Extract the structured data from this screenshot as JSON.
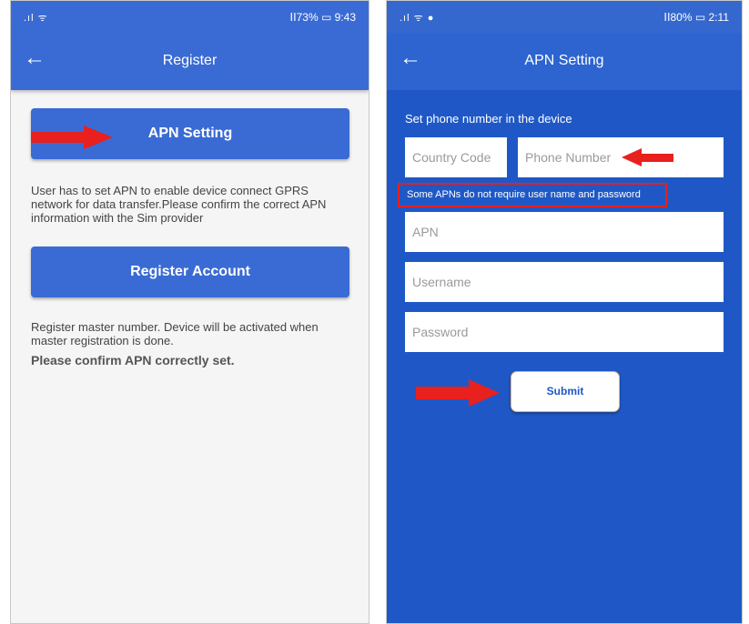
{
  "colors": {
    "primary": "#3a6bd4",
    "background_blue": "#1f58c6",
    "arrow_red": "#e8201e"
  },
  "icons": {
    "back": "arrow-left-icon",
    "pointer": "red-arrow-icon"
  },
  "left_screen": {
    "status_bar": {
      "signal": ".ıl ᯤ",
      "battery": "ⅠⅠ73% ▭ 9:43"
    },
    "app_bar": {
      "back_glyph": "←",
      "title": "Register"
    },
    "apn_button_label": "APN Setting",
    "apn_description": "User has to set APN to enable device connect GPRS network for data transfer.Please confirm the correct APN information with the Sim provider",
    "register_button_label": "Register Account",
    "register_description": "Register master number. Device will be activated when master registration is done.",
    "confirm_note": "Please confirm APN correctly set."
  },
  "right_screen": {
    "status_bar": {
      "signal": ".ıl ᯤ ●",
      "battery": "ⅠⅠ80% ▭ 2:11"
    },
    "app_bar": {
      "back_glyph": "←",
      "title": "APN Setting"
    },
    "section_label": "Set phone number in the device",
    "country_code_placeholder": "Country Code",
    "phone_number_placeholder": "Phone Number",
    "apn_notice": "Some APNs do not require user name and password",
    "apn_placeholder": "APN",
    "username_placeholder": "Username",
    "password_placeholder": "Password",
    "submit_label": "Submit"
  }
}
